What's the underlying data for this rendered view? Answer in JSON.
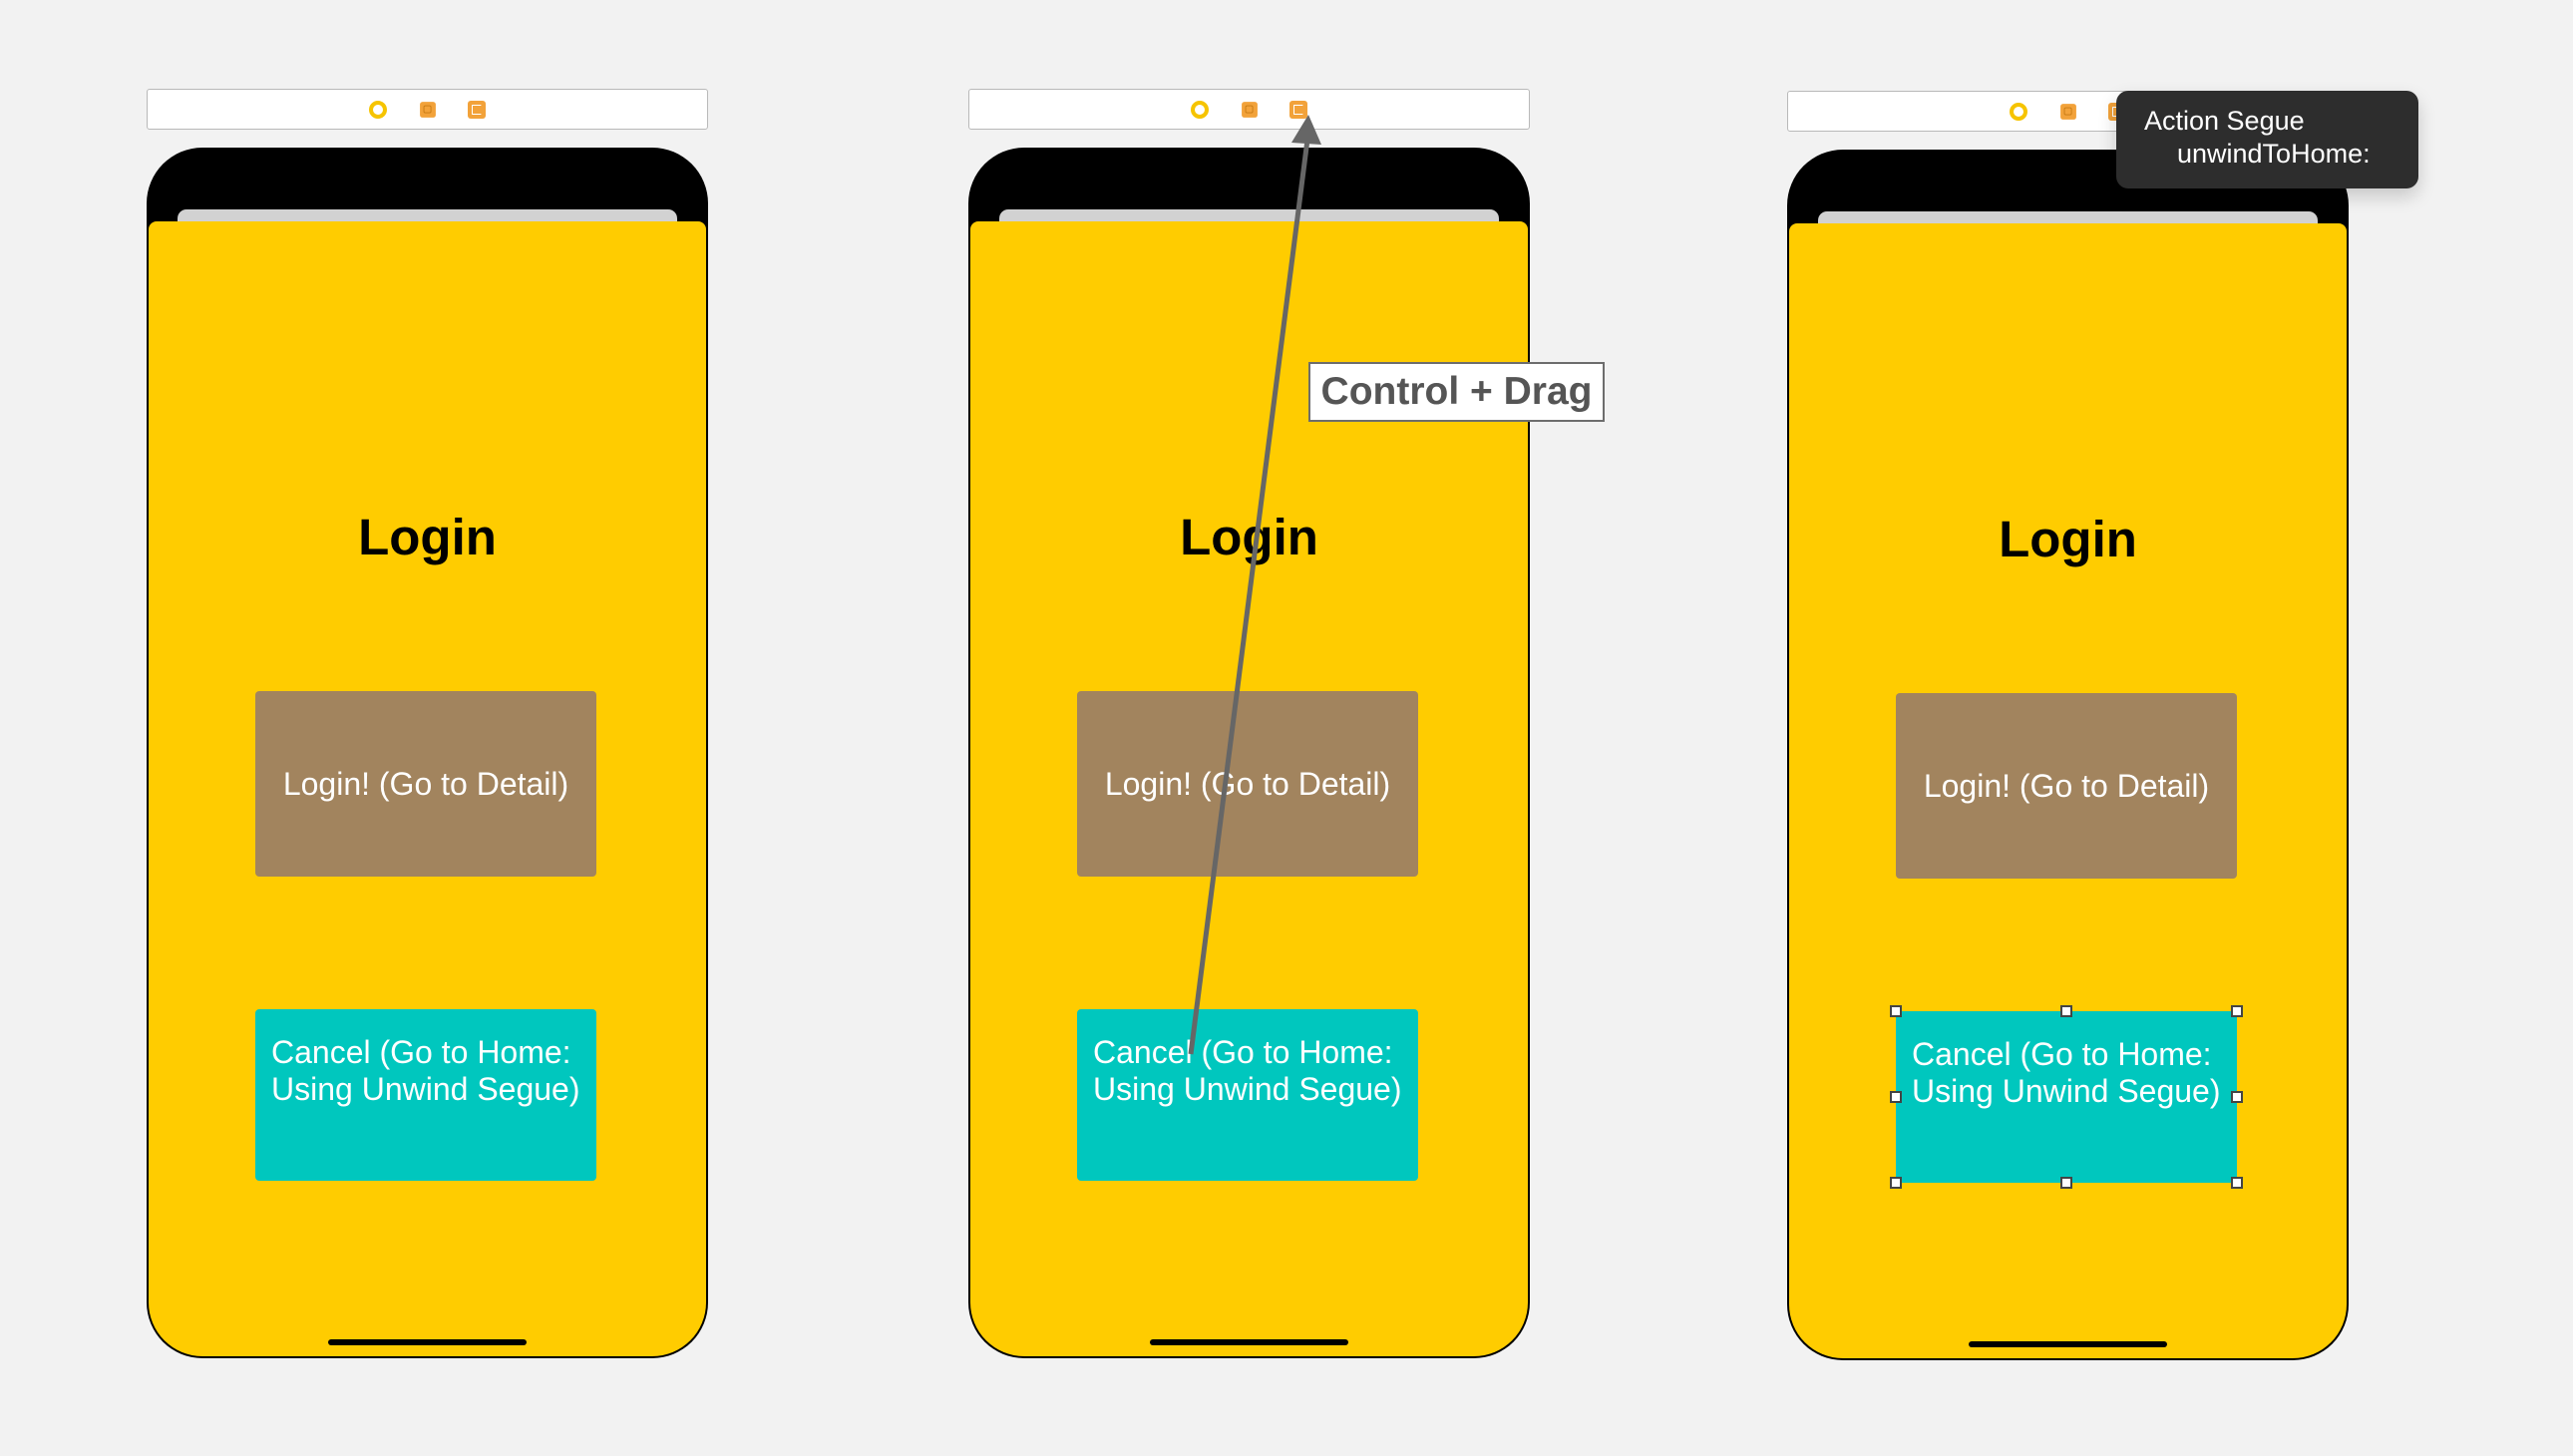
{
  "scenes": [
    {
      "title": "Login",
      "login_button": "Login! (Go to Detail)",
      "cancel_button": "Cancel (Go to Home: Using Unwind Segue)"
    },
    {
      "title": "Login",
      "login_button": "Login! (Go to Detail)",
      "cancel_button": "Cancel (Go to Home: Using Unwind Segue)"
    },
    {
      "title": "Login",
      "login_button": "Login! (Go to Detail)",
      "cancel_button": "Cancel (Go to Home: Using Unwind Segue)"
    }
  ],
  "annotation": {
    "label": "Control + Drag",
    "line_color": "#666666"
  },
  "segue_popup": {
    "title": "Action Segue",
    "item": "unwindToHome:"
  },
  "colors": {
    "screen_background": "#ffcc00",
    "login_button": "#a2845e",
    "cancel_button": "#00c7be",
    "view_controller_icon": "#f6c400",
    "first_responder_icon": "#f2a23a",
    "exit_icon": "#f2a23a"
  },
  "icons": {
    "dock": [
      "view-controller-icon",
      "first-responder-icon",
      "exit-icon"
    ]
  }
}
